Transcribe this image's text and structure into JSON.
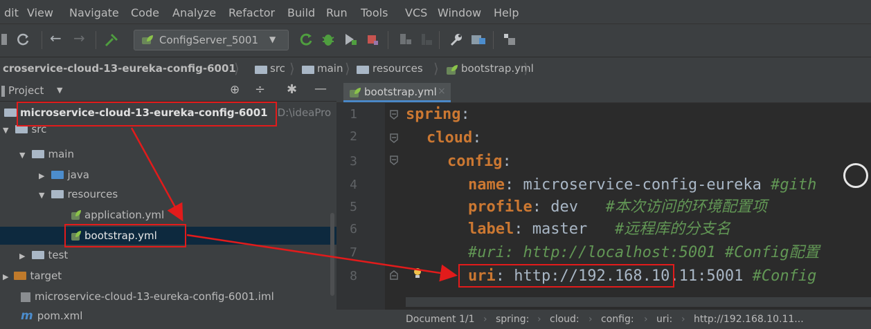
{
  "menu": [
    "dit",
    "View",
    "Navigate",
    "Code",
    "Analyze",
    "Refactor",
    "Build",
    "Run",
    "Tools",
    "VCS",
    "Window",
    "Help"
  ],
  "toolbar": {
    "run_config": "ConfigServer_5001",
    "dropdown_arrow": "▼"
  },
  "breadcrumb": {
    "items": [
      "croservice-cloud-13-eureka-config-6001",
      "src",
      "main",
      "resources",
      "bootstrap.yml"
    ]
  },
  "project_panel": {
    "title": "Project",
    "title_arrow": "▼",
    "root_name": "microservice-cloud-13-eureka-config-6001",
    "root_path": "D:\\ideaPro",
    "tree": {
      "src": "src",
      "main": "main",
      "java": "java",
      "resources": "resources",
      "application": "application.yml",
      "bootstrap": "bootstrap.yml",
      "test": "test",
      "target": "target",
      "iml": "microservice-cloud-13-eureka-config-6001.iml",
      "pom": "pom.xml"
    }
  },
  "editor": {
    "tab_label": "bootstrap.yml",
    "line_numbers": [
      "1",
      "2",
      "3",
      "4",
      "5",
      "6",
      "7",
      "8"
    ],
    "code": {
      "l1_key": "spring",
      "l2_key": "cloud",
      "l3_key": "config",
      "l4_key": "name",
      "l4_val": " microservice-config-eureka ",
      "l4_comment": "#gith",
      "l5_key": "profile",
      "l5_val": " dev   ",
      "l5_comment": "#本次访问的环境配置项",
      "l6_key": "label",
      "l6_val": " master   ",
      "l6_comment": "#远程库的分支名",
      "l7_comment": "#uri: http://localhost:5001 #Config配置",
      "l8_key": "uri",
      "l8_val": " http://192.168.10.11:5001",
      "l8_comment": " #Config"
    },
    "status": {
      "doc": "Document 1/1",
      "path": [
        "spring:",
        "cloud:",
        "config:",
        "uri:",
        "http://192.168.10.11..."
      ]
    }
  },
  "colors": {
    "annotation_red": "#e21b1b",
    "ide_bg": "#2b2b2b",
    "panel_bg": "#3c3f41",
    "keyword": "#cc7832",
    "comment": "#629755"
  }
}
